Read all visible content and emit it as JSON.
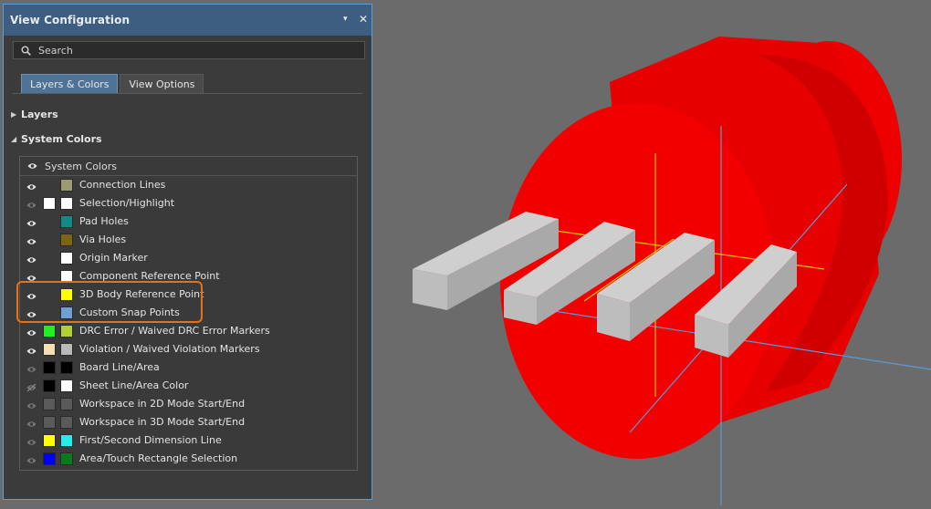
{
  "panel": {
    "title": "View Configuration",
    "pin_glyph": "▾",
    "close_glyph": "✕",
    "search_placeholder": "Search",
    "tabs": [
      {
        "label": "Layers & Colors",
        "active": true
      },
      {
        "label": "View Options",
        "active": false
      }
    ],
    "sections": [
      {
        "label": "Layers",
        "expanded": false
      },
      {
        "label": "System Colors",
        "expanded": true
      }
    ],
    "list_header": "System Colors",
    "rows": [
      {
        "label": "Connection Lines",
        "eye": "on",
        "sw1": null,
        "sw2": "#9b9b73"
      },
      {
        "label": "Selection/Highlight",
        "eye": "dim",
        "sw1": "#ffffff",
        "sw2": "#ffffff"
      },
      {
        "label": "Pad Holes",
        "eye": "on",
        "sw1": null,
        "sw2": "#138a87"
      },
      {
        "label": "Via Holes",
        "eye": "on",
        "sw1": null,
        "sw2": "#7d6410"
      },
      {
        "label": "Origin Marker",
        "eye": "on",
        "sw1": null,
        "sw2": "#ffffff"
      },
      {
        "label": "Component Reference Point",
        "eye": "on",
        "sw1": null,
        "sw2": "#ffffff"
      },
      {
        "label": "3D Body Reference Point",
        "eye": "on",
        "sw1": null,
        "sw2": "#ffff00"
      },
      {
        "label": "Custom Snap Points",
        "eye": "on",
        "sw1": null,
        "sw2": "#6ea0d6"
      },
      {
        "label": "DRC Error / Waived DRC Error Markers",
        "eye": "on",
        "sw1": "#22ee22",
        "sw2": "#b5d035"
      },
      {
        "label": "Violation / Waived Violation Markers",
        "eye": "on",
        "sw1": "#f5deb3",
        "sw2": "#b9b9b9"
      },
      {
        "label": "Board Line/Area",
        "eye": "dim",
        "sw1": "#000000",
        "sw2": "#000000"
      },
      {
        "label": "Sheet Line/Area Color",
        "eye": "off",
        "sw1": "#000000",
        "sw2": "#ffffff"
      },
      {
        "label": "Workspace in 2D Mode Start/End",
        "eye": "dim",
        "sw1": "#5a5a5a",
        "sw2": "#5a5a5a"
      },
      {
        "label": "Workspace in 3D Mode Start/End",
        "eye": "dim",
        "sw1": "#5a5a5a",
        "sw2": "#5a5a5a"
      },
      {
        "label": "First/Second Dimension Line",
        "eye": "dim",
        "sw1": "#ffff00",
        "sw2": "#22eeee"
      },
      {
        "label": "Area/Touch Rectangle Selection",
        "eye": "dim",
        "sw1": "#0000ee",
        "sw2": "#0a7a1a"
      }
    ]
  },
  "colors": {
    "title_bar": "#3d5e80",
    "panel_bg": "#3b3b3b",
    "highlight": "#e0731c",
    "workspace_bg": "#6b6b6b",
    "body_red": "#ee0000",
    "pin_grey": "#b4b4b4",
    "axis_blue": "#5b9bd5",
    "axis_yellow": "#e6c800"
  }
}
